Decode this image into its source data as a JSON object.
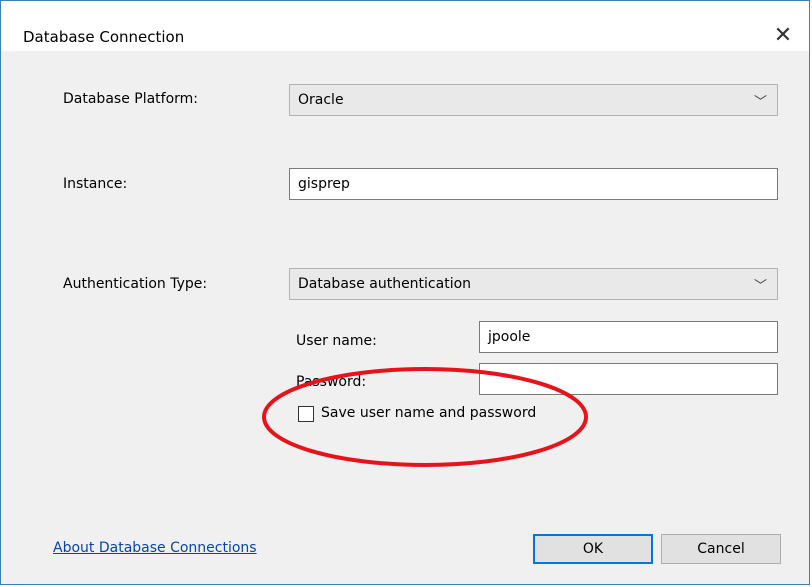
{
  "window": {
    "title": "Database Connection"
  },
  "platform": {
    "label": "Database Platform:",
    "value": "Oracle"
  },
  "instance": {
    "label": "Instance:",
    "value": "gisprep"
  },
  "auth": {
    "label": "Authentication Type:",
    "value": "Database authentication"
  },
  "username": {
    "label": "User name:",
    "value": "jpoole"
  },
  "password": {
    "label": "Password:",
    "value": ""
  },
  "save_credentials": {
    "label": "Save user name and password",
    "checked": false
  },
  "about_link": "About Database Connections",
  "buttons": {
    "ok": "OK",
    "cancel": "Cancel"
  },
  "icons": {
    "close": "close-icon",
    "chevron": "chevron-down-icon"
  },
  "colors": {
    "annotation": "#e8121a",
    "link": "#0645ad",
    "accent": "#0078d7"
  }
}
